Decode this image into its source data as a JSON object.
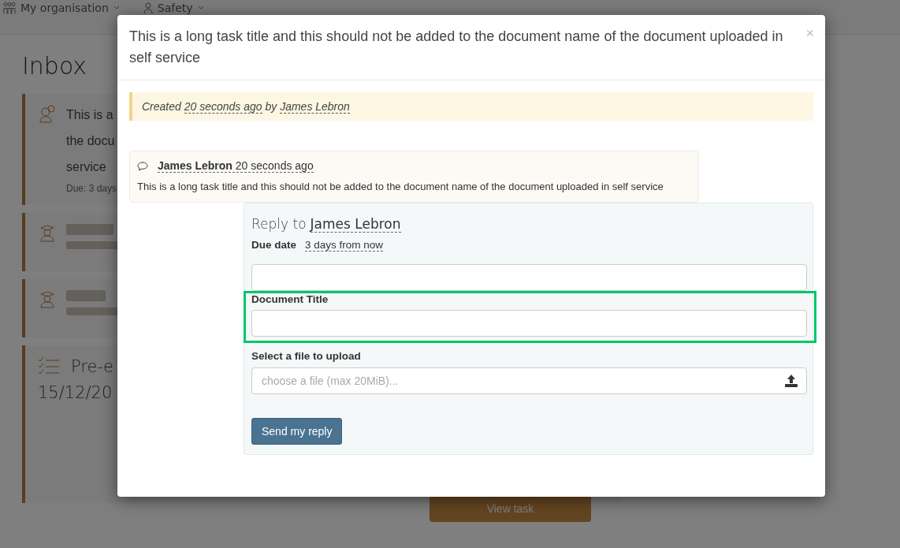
{
  "nav": {
    "items": [
      {
        "label": "My organisation"
      },
      {
        "label": "Safety"
      }
    ]
  },
  "page": {
    "title": "Inbox",
    "first_card": {
      "lines": [
        "This is a",
        "the docu",
        "service"
      ],
      "due": "Due: 3 days"
    },
    "section": {
      "title": "Pre-e",
      "date": "15/12/20"
    },
    "view_button": "View task"
  },
  "modal": {
    "title": "This is a long task title and this should not be added to the document name of the document uploaded in self service",
    "close": "×",
    "created": {
      "prefix": "Created",
      "time": "20 seconds ago",
      "middle": "by",
      "author": "James Lebron"
    },
    "comment": {
      "author": "James Lebron",
      "time": "20 seconds ago",
      "text": "This is a long task title and this should not be added to the document name of the document uploaded in self service"
    },
    "reply": {
      "heading": "Reply to",
      "recipient": "James Lebron",
      "due_label": "Due date",
      "due_value": "3 days from now",
      "document_title_label": "Document Title",
      "file_label": "Select a file to upload",
      "file_placeholder": "choose a file (max 20MiB)...",
      "submit": "Send my reply"
    }
  }
}
